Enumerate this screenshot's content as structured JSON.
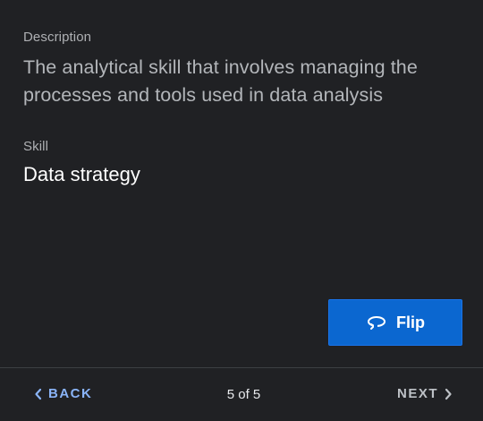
{
  "card": {
    "description_label": "Description",
    "description_text": "The analytical skill that involves managing the processes and tools used in data analysis",
    "skill_label": "Skill",
    "skill_text": "Data strategy",
    "flip_label": "Flip",
    "flip_icon": "rotate-icon"
  },
  "footer": {
    "back_label": "BACK",
    "next_label": "NEXT",
    "counter": "5 of 5"
  },
  "colors": {
    "background": "#202124",
    "accent_button": "#0b67d0",
    "back_link": "#8ab4f8"
  }
}
